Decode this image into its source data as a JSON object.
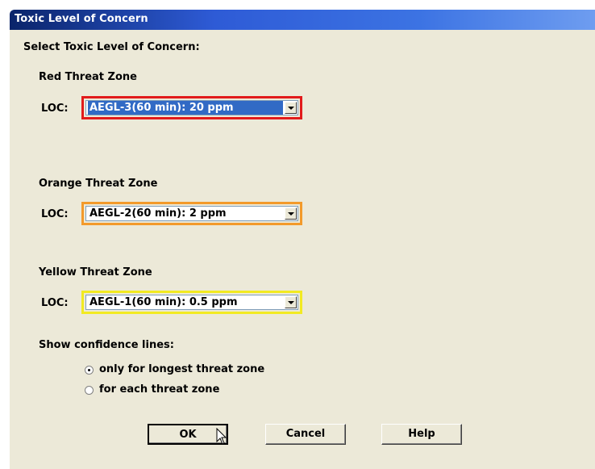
{
  "window": {
    "title": "Toxic Level of Concern"
  },
  "heading": "Select Toxic Level of Concern:",
  "zones": [
    {
      "name": "Red Threat Zone",
      "loc_label": "LOC:",
      "value": "AEGL-3(60 min): 20 ppm",
      "color": "#e21b1b",
      "selected": true
    },
    {
      "name": "Orange Threat Zone",
      "loc_label": "LOC:",
      "value": "AEGL-2(60 min): 2 ppm",
      "color": "#f39a2b",
      "selected": false
    },
    {
      "name": "Yellow Threat Zone",
      "loc_label": "LOC:",
      "value": "AEGL-1(60 min): 0.5 ppm",
      "color": "#f2ea22",
      "selected": false
    }
  ],
  "confidence": {
    "label": "Show confidence lines:",
    "options": [
      {
        "label": "only for longest threat zone",
        "checked": true
      },
      {
        "label": "for each threat zone",
        "checked": false
      }
    ]
  },
  "buttons": {
    "ok": "OK",
    "cancel": "Cancel",
    "help": "Help"
  },
  "icons": {
    "cursor": "arrow-cursor-icon",
    "dropdown": "chevron-down-icon"
  }
}
